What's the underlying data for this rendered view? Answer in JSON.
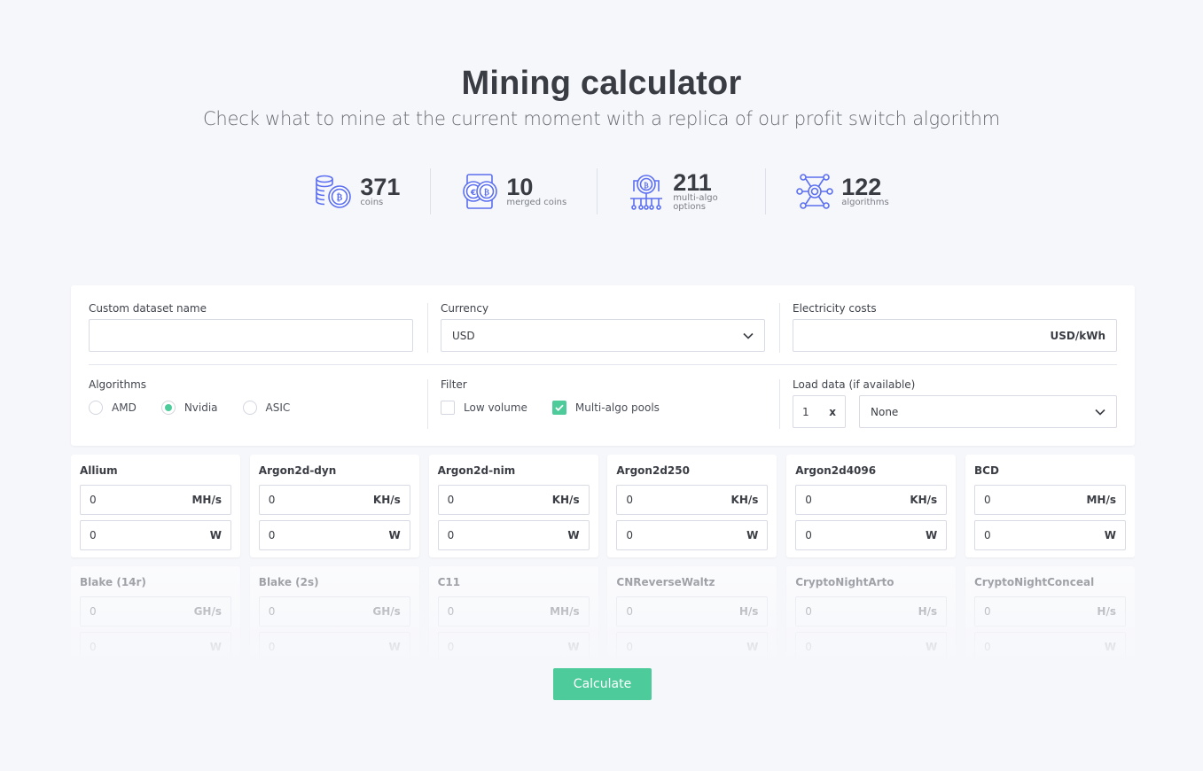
{
  "hero": {
    "title": "Mining calculator",
    "subtitle": "Check what to mine at the current moment with a replica of our profit switch algorithm"
  },
  "stats": [
    {
      "icon": "coins-stack-icon",
      "value": "371",
      "label": "coins"
    },
    {
      "icon": "merged-coins-icon",
      "value": "10",
      "label": "merged coins"
    },
    {
      "icon": "multi-algo-circuit-icon",
      "value": "211",
      "label": "multi-algo options"
    },
    {
      "icon": "algorithm-network-icon",
      "value": "122",
      "label": "algorithms"
    }
  ],
  "form": {
    "dataset": {
      "label": "Custom dataset name",
      "value": ""
    },
    "currency": {
      "label": "Currency",
      "value": "USD"
    },
    "electricity": {
      "label": "Electricity costs",
      "value": "",
      "unit": "USD/kWh"
    },
    "algorithms": {
      "label": "Algorithms",
      "options": [
        "AMD",
        "Nvidia",
        "ASIC"
      ],
      "selected": "Nvidia"
    },
    "filter": {
      "label": "Filter",
      "options": [
        {
          "label": "Low volume",
          "checked": false
        },
        {
          "label": "Multi-algo pools",
          "checked": true
        }
      ]
    },
    "load": {
      "label": "Load data (if available)",
      "qty": "1",
      "x": "x",
      "value": "None"
    }
  },
  "algos": [
    {
      "name": "Allium",
      "hash": "0",
      "hash_unit": "MH/s",
      "power": "0",
      "power_unit": "W"
    },
    {
      "name": "Argon2d-dyn",
      "hash": "0",
      "hash_unit": "KH/s",
      "power": "0",
      "power_unit": "W"
    },
    {
      "name": "Argon2d-nim",
      "hash": "0",
      "hash_unit": "KH/s",
      "power": "0",
      "power_unit": "W"
    },
    {
      "name": "Argon2d250",
      "hash": "0",
      "hash_unit": "KH/s",
      "power": "0",
      "power_unit": "W"
    },
    {
      "name": "Argon2d4096",
      "hash": "0",
      "hash_unit": "KH/s",
      "power": "0",
      "power_unit": "W"
    },
    {
      "name": "BCD",
      "hash": "0",
      "hash_unit": "MH/s",
      "power": "0",
      "power_unit": "W"
    },
    {
      "name": "Blake (14r)",
      "hash": "0",
      "hash_unit": "GH/s",
      "power": "0",
      "power_unit": "W"
    },
    {
      "name": "Blake (2s)",
      "hash": "0",
      "hash_unit": "GH/s",
      "power": "0",
      "power_unit": "W"
    },
    {
      "name": "C11",
      "hash": "0",
      "hash_unit": "MH/s",
      "power": "0",
      "power_unit": "W"
    },
    {
      "name": "CNReverseWaltz",
      "hash": "0",
      "hash_unit": "H/s",
      "power": "0",
      "power_unit": "W"
    },
    {
      "name": "CryptoNightArto",
      "hash": "0",
      "hash_unit": "H/s",
      "power": "0",
      "power_unit": "W"
    },
    {
      "name": "CryptoNightConceal",
      "hash": "0",
      "hash_unit": "H/s",
      "power": "0",
      "power_unit": "W"
    }
  ],
  "calculate_label": "Calculate",
  "colors": {
    "accent": "#4ecb9b",
    "icon": "#5b6ff0",
    "background": "#f6f7fb"
  }
}
